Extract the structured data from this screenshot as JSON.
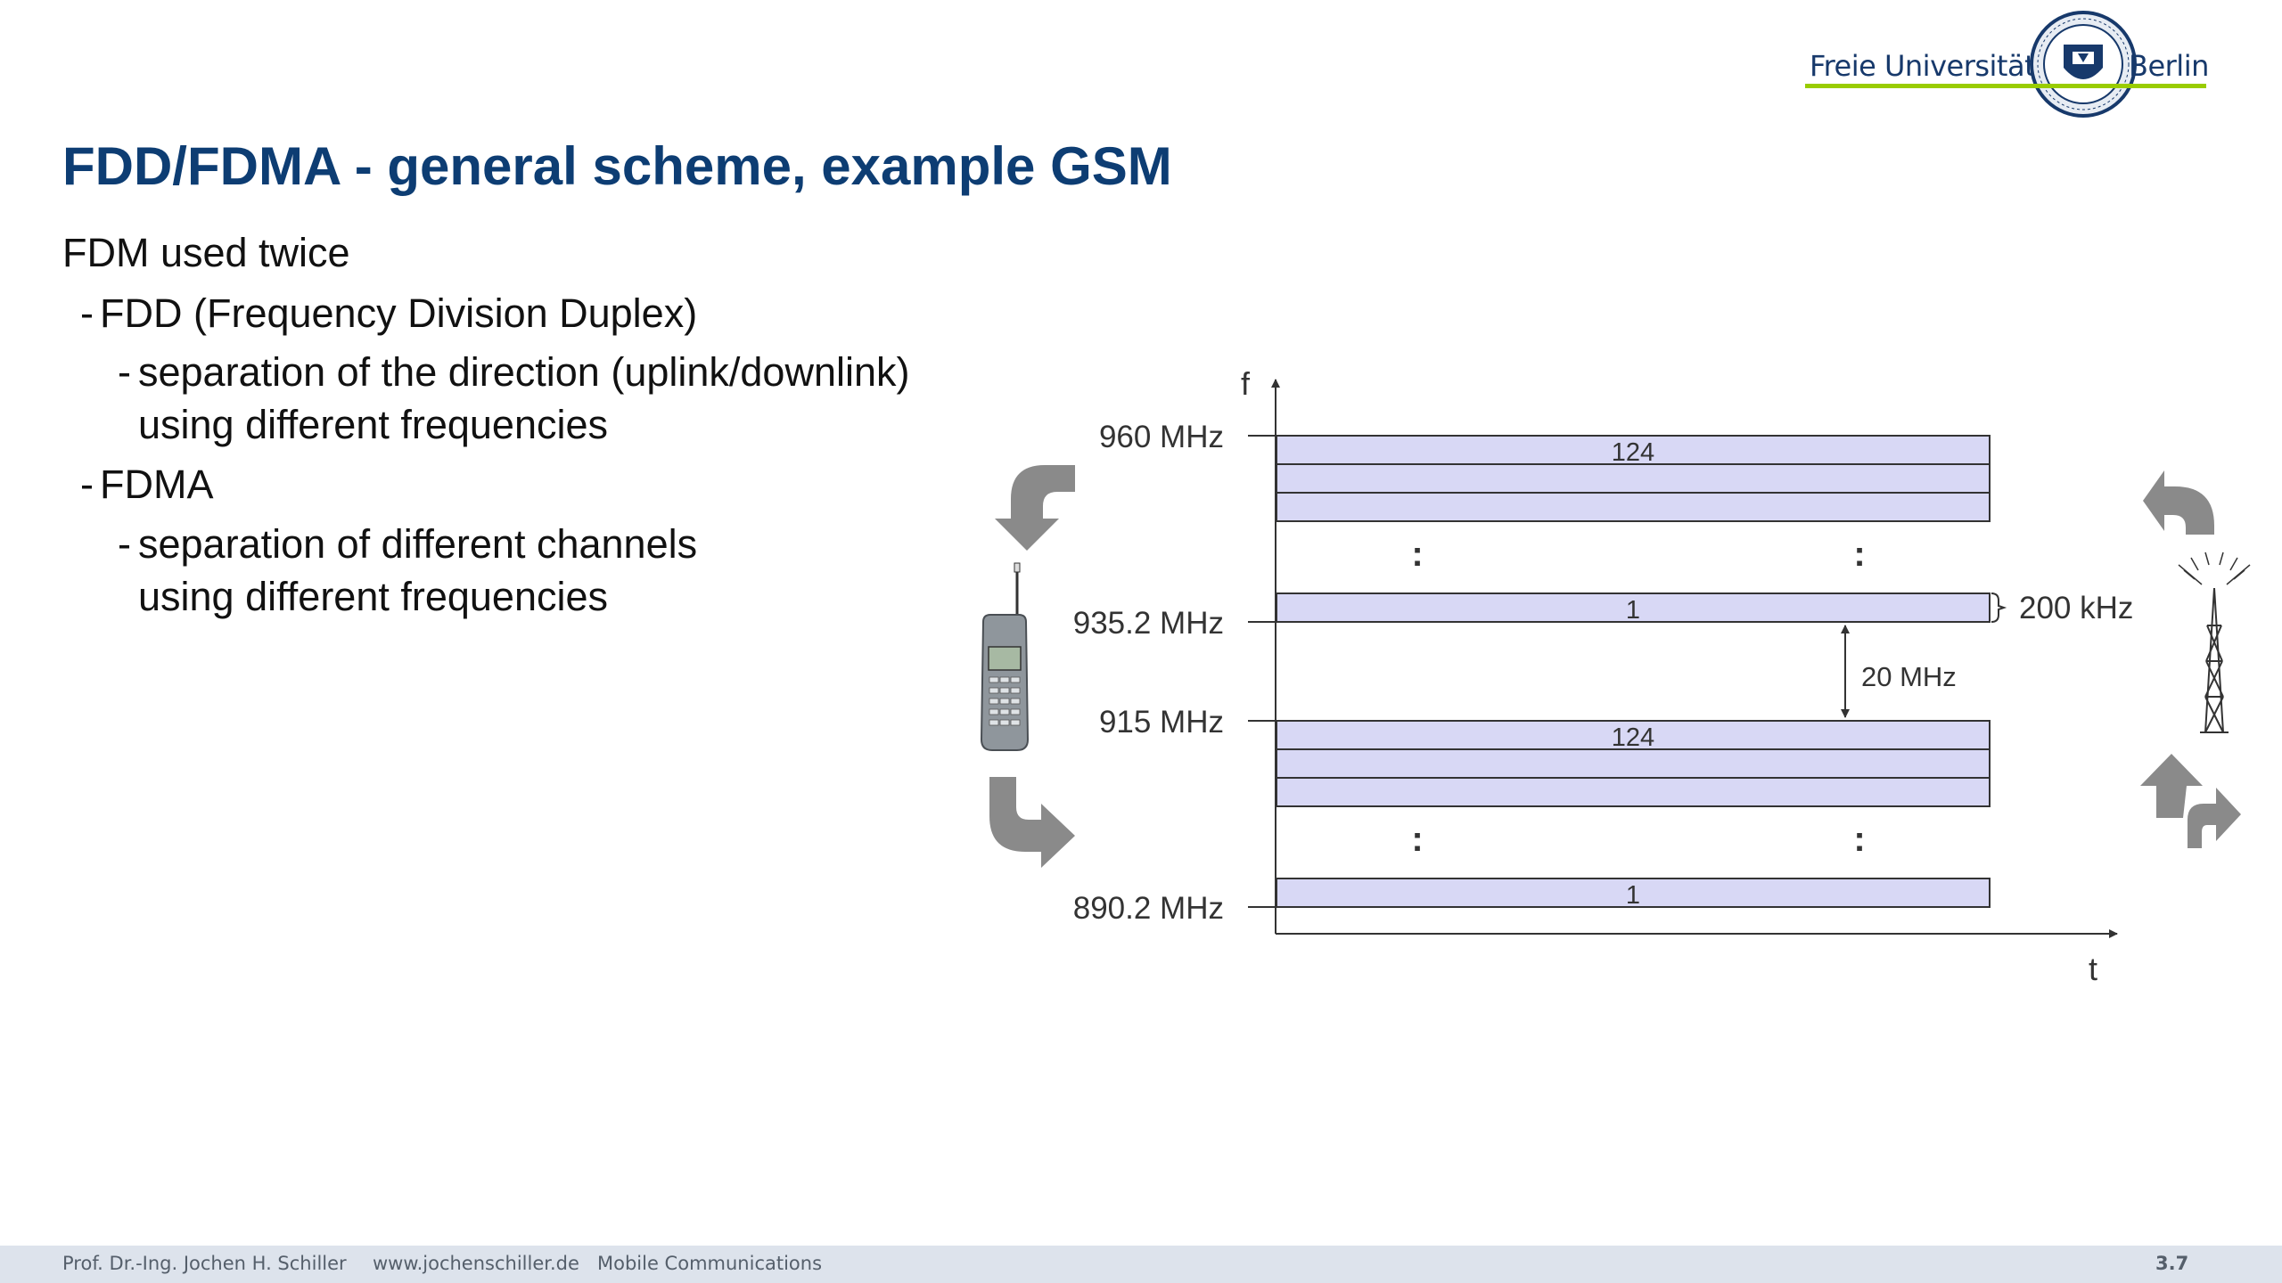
{
  "header": {
    "logo": {
      "text_left": "Freie Universität",
      "text_right": "Berlin"
    }
  },
  "slide": {
    "title": "FDD/FDMA - general scheme, example GSM",
    "bullets": {
      "l0": "FDM used twice",
      "l1a": "FDD (Frequency Division Duplex)",
      "l2a_line1": "separation of the direction (uplink/downlink)",
      "l2a_line2": "using different frequencies",
      "l1b": "FDMA",
      "l2b_line1": "separation of different channels",
      "l2b_line2": "using different frequencies"
    },
    "dash": "-"
  },
  "diagram": {
    "y_axis_label": "f",
    "x_axis_label": "t",
    "freq_labels": [
      "960 MHz",
      "935.2 MHz",
      "915 MHz",
      "890.2 MHz"
    ],
    "channel_top_label": "124",
    "channel_bottom_label": "1",
    "dots": ":",
    "duplex_spacing": "20 MHz",
    "channel_width": "200 kHz",
    "colors": {
      "band_fill": "#d8d8f5",
      "line": "#333333",
      "arrow_gray": "#8a8a8a"
    },
    "icons": {
      "handset": "mobile-phone-icon",
      "base_station": "antenna-tower-icon"
    }
  },
  "footer": {
    "author": "Prof. Dr.-Ing. Jochen H. Schiller",
    "website": "www.jochenschiller.de",
    "course": "Mobile Communications",
    "page": "3.7"
  }
}
